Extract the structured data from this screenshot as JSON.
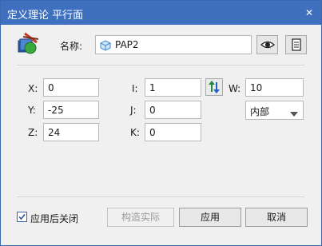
{
  "window": {
    "title": "定义理论 平行面",
    "close_icon": "close-icon"
  },
  "header": {
    "name_label": "名称:",
    "name_value": "PAP2",
    "icons": [
      "plane-tool-icon",
      "cube-icon",
      "eye-icon",
      "list-icon"
    ]
  },
  "position": {
    "x_label": "X:",
    "x_value": "0",
    "y_label": "Y:",
    "y_value": "-25",
    "z_label": "Z:",
    "z_value": "24"
  },
  "direction": {
    "i_label": "I:",
    "i_value": "1",
    "j_label": "J:",
    "j_value": "0",
    "k_label": "K:",
    "k_value": "0",
    "swap_icon": "swap-arrows-icon"
  },
  "size": {
    "w_label": "W:",
    "w_value": "10",
    "side_selected": "内部"
  },
  "footer": {
    "close_after_apply_label": "应用后关闭",
    "close_after_apply_checked": true,
    "construct_label": "构造实际",
    "apply_label": "应用",
    "cancel_label": "取消"
  },
  "colors": {
    "titlebar": "#3f70bf",
    "swap_up": "#1e8a3c",
    "swap_down": "#1f5fc4"
  }
}
